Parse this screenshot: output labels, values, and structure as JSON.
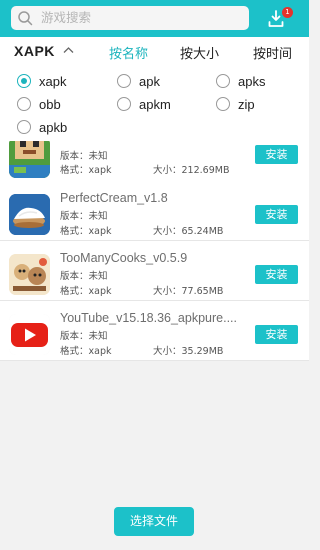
{
  "search": {
    "placeholder": "游戏搜索"
  },
  "downloads": {
    "badge_count": "1"
  },
  "sort_bar": {
    "filter_label": "XAPK",
    "options": [
      "按名称",
      "按大小",
      "按时间"
    ],
    "active_index": 0
  },
  "filters": {
    "selected": "xapk",
    "options": [
      "xapk",
      "apk",
      "apks",
      "obb",
      "apkm",
      "zip",
      "apkb"
    ]
  },
  "labels": {
    "version": "版本：未知",
    "format_prefix": "格式：",
    "size_prefix": "大小：",
    "install": "安装"
  },
  "apps": [
    {
      "name": "",
      "format": "xapk",
      "size": "212.69MB"
    },
    {
      "name": "PerfectCream_v1.8",
      "format": "xapk",
      "size": "65.24MB"
    },
    {
      "name": "TooManyCooks_v0.5.9",
      "format": "xapk",
      "size": "77.65MB"
    },
    {
      "name": "YouTube_v15.18.36_apkpure....",
      "format": "xapk",
      "size": "35.29MB"
    }
  ],
  "bottom": {
    "choose_file": "选择文件"
  },
  "colors": {
    "accent": "#1cc1c9",
    "badge": "#e5322d"
  }
}
